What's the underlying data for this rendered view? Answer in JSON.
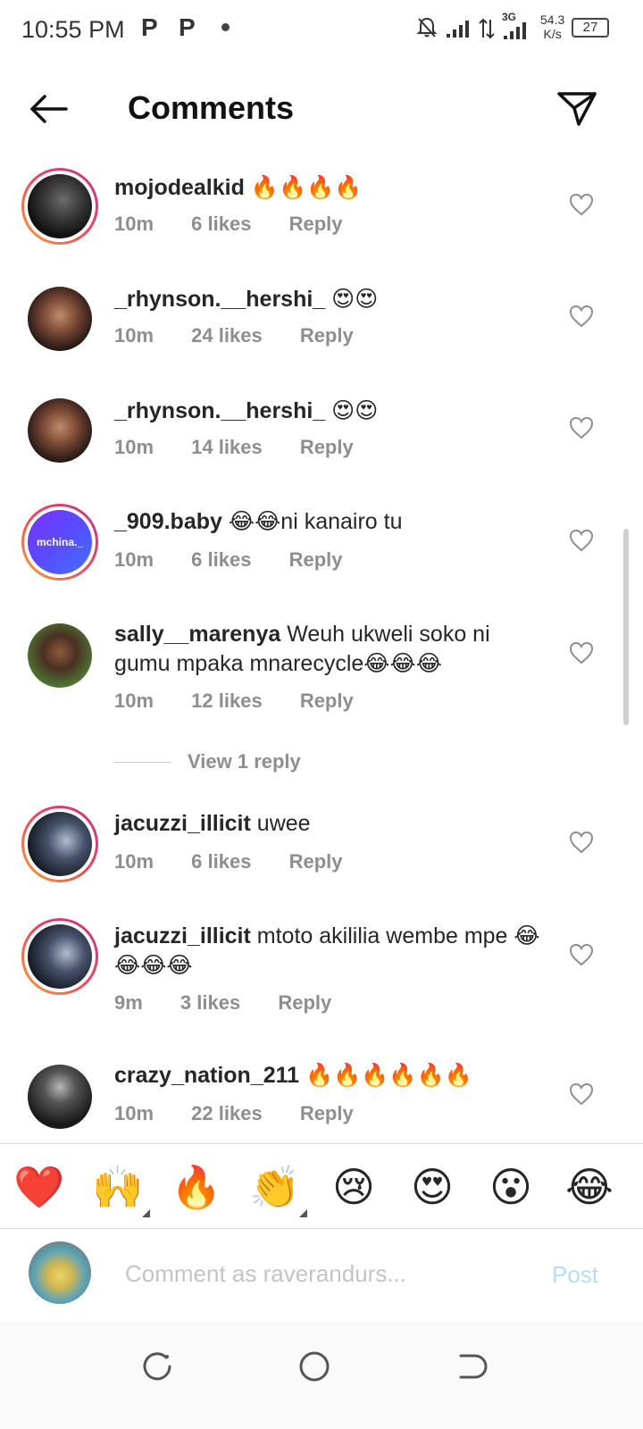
{
  "status_bar": {
    "time": "10:55 PM",
    "notif_icons": [
      "P",
      "P"
    ],
    "network": "3G",
    "speed_value": "54.3",
    "speed_unit": "K/s",
    "battery": "27"
  },
  "header": {
    "title": "Comments"
  },
  "comments": [
    {
      "username": "mojodealkid",
      "text": " 🔥🔥🔥🔥",
      "time": "10m",
      "likes": "6 likes",
      "reply": "Reply"
    },
    {
      "username": "_rhynson.__hershi_",
      "text": " 😍😍",
      "time": "10m",
      "likes": "24 likes",
      "reply": "Reply"
    },
    {
      "username": "_rhynson.__hershi_",
      "text": " 😍😍",
      "time": "10m",
      "likes": "14 likes",
      "reply": "Reply"
    },
    {
      "username": "_909.baby",
      "text": " 😂😂ni kanairo tu",
      "time": "10m",
      "likes": "6 likes",
      "reply": "Reply",
      "avatar_text": "mchina._"
    },
    {
      "username": "sally__marenya",
      "text": " Weuh ukweli soko ni gumu mpaka mnarecycle😂😂😂",
      "time": "10m",
      "likes": "12 likes",
      "reply": "Reply"
    },
    {
      "username": "jacuzzi_illicit",
      "text": " uwee",
      "time": "10m",
      "likes": "6 likes",
      "reply": "Reply"
    },
    {
      "username": "jacuzzi_illicit",
      "text": " mtoto akililia wembe mpe 😂😂😂😂",
      "time": "9m",
      "likes": "3 likes",
      "reply": "Reply"
    },
    {
      "username": "crazy_nation_211",
      "text": " 🔥🔥🔥🔥🔥🔥",
      "time": "10m",
      "likes": "22 likes",
      "reply": "Reply"
    }
  ],
  "view_replies": "View 1 reply",
  "emoji_bar": [
    "❤️",
    "🙌",
    "🔥",
    "👏",
    "😢",
    "😍",
    "😮",
    "😂"
  ],
  "comment_input": {
    "placeholder": "Comment as raverandurs...",
    "post_label": "Post"
  },
  "colors": {
    "accent_disabled": "#b9dcf6",
    "meta": "#8e8e8e",
    "story_ring": "#ec4a5d"
  }
}
